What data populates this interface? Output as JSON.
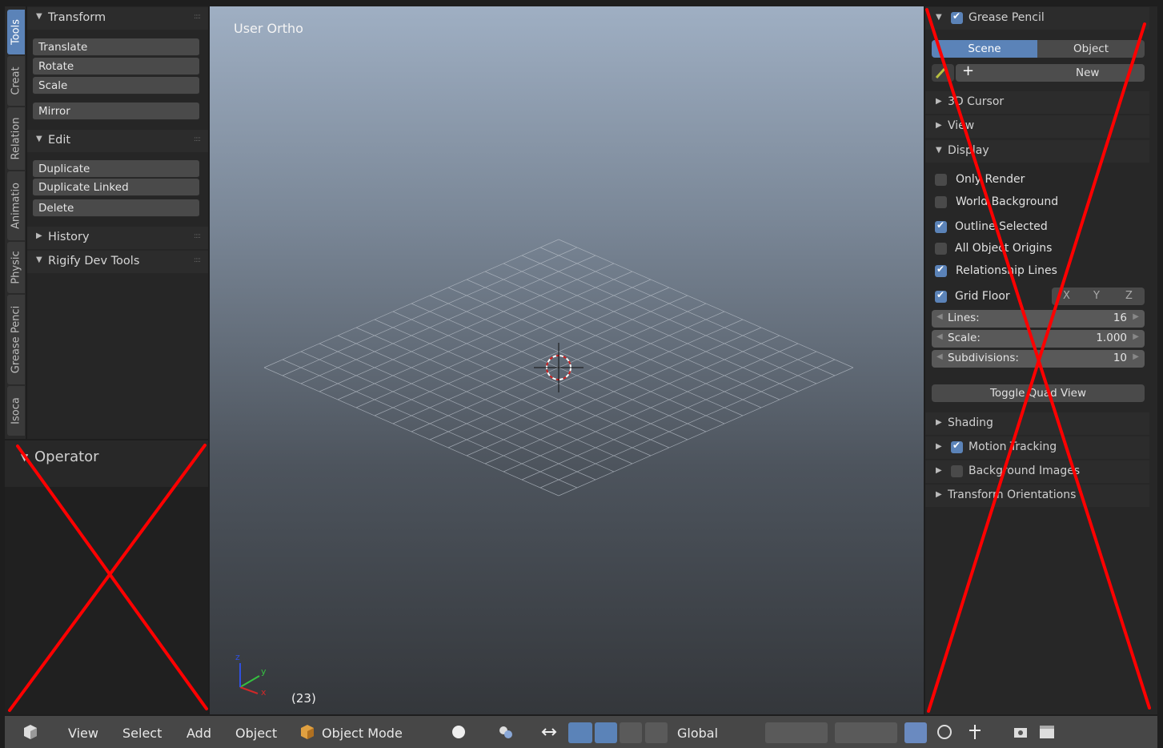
{
  "tool_tabs": [
    "Tools",
    "Creat",
    "Relation",
    "Animatio",
    "Physic",
    "Grease Penci",
    "Isoca"
  ],
  "tool_panel": {
    "transform": {
      "title": "Transform",
      "buttons": [
        "Translate",
        "Rotate",
        "Scale"
      ],
      "mirror": "Mirror"
    },
    "edit": {
      "title": "Edit",
      "buttons": [
        "Duplicate",
        "Duplicate Linked",
        "Delete"
      ]
    },
    "history": "History",
    "rigify": "Rigify Dev Tools"
  },
  "operator": {
    "title": "Operator"
  },
  "viewport": {
    "title": "User Ortho",
    "frame": "(23)",
    "axes": [
      "x",
      "y",
      "z"
    ]
  },
  "properties": {
    "grease_pencil": {
      "title": "Grease Pencil",
      "checked": true,
      "tabs": [
        "Scene",
        "Object"
      ],
      "active_tab": "Scene",
      "new_label": "New"
    },
    "sections": [
      "3D Cursor",
      "View"
    ],
    "display": {
      "title": "Display",
      "options": [
        {
          "label": "Only Render",
          "checked": false
        },
        {
          "label": "World Background",
          "checked": false
        },
        {
          "label": "Outline Selected",
          "checked": true
        },
        {
          "label": "All Object Origins",
          "checked": false
        },
        {
          "label": "Relationship Lines",
          "checked": true
        }
      ],
      "grid_floor": {
        "label": "Grid Floor",
        "checked": true,
        "axes": [
          "X",
          "Y",
          "Z"
        ]
      },
      "fields": [
        {
          "label": "Lines:",
          "value": "16"
        },
        {
          "label": "Scale:",
          "value": "1.000"
        },
        {
          "label": "Subdivisions:",
          "value": "10"
        }
      ],
      "toggle_quad": "Toggle Quad View"
    },
    "after_sections": [
      {
        "label": "Shading",
        "checkbox": null
      },
      {
        "label": "Motion Tracking",
        "checkbox": true
      },
      {
        "label": "Background Images",
        "checkbox": false
      },
      {
        "label": "Transform Orientations",
        "checkbox": null
      }
    ]
  },
  "header": {
    "menus": [
      "View",
      "Select",
      "Add",
      "Object"
    ],
    "mode": "Object Mode",
    "orientation": "Global"
  },
  "overlay_color": "#ff0000",
  "accent_color": "#5b83b8"
}
